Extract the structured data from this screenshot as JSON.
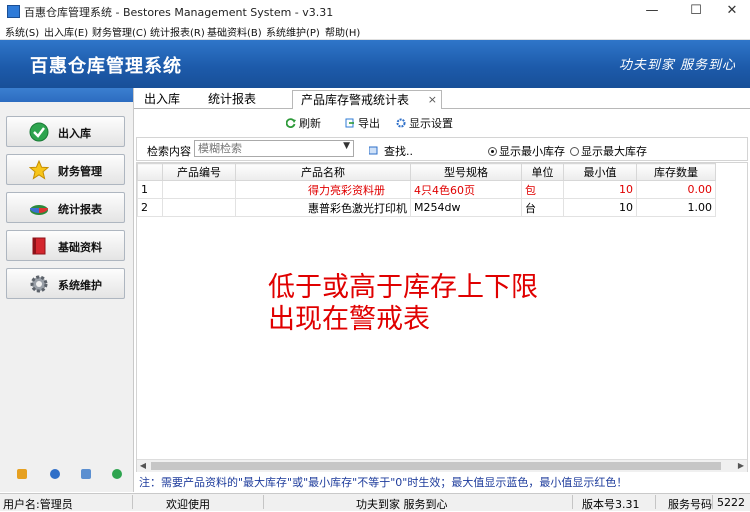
{
  "window": {
    "title": "百惠仓库管理系统 - Bestores Management System - v3.31",
    "minimize": "—",
    "maximize": "☐",
    "close": "✕"
  },
  "menu": [
    "系统(S)",
    "出入库(E)",
    "财务管理(C)",
    "统计报表(R)",
    "基础资料(B)",
    "系统维护(P)",
    "帮助(H)"
  ],
  "banner": {
    "logo": "百惠仓库管理系统",
    "slogan": "功夫到家 服务到心"
  },
  "nav": [
    {
      "label": "出入库",
      "icon": "green-check-icon"
    },
    {
      "label": "财务管理",
      "icon": "star-icon"
    },
    {
      "label": "统计报表",
      "icon": "pie-chart-icon"
    },
    {
      "label": "基础资料",
      "icon": "book-icon"
    },
    {
      "label": "系统维护",
      "icon": "gear-icon"
    }
  ],
  "tabs": [
    {
      "label": "出入库",
      "active": false
    },
    {
      "label": "统计报表",
      "active": false
    },
    {
      "label": "产品库存警戒统计表",
      "active": true,
      "close": "×"
    }
  ],
  "toolbar": {
    "refresh": "刷新",
    "export": "导出",
    "display_settings": "显示设置"
  },
  "search": {
    "label": "检索内容",
    "placeholder": "模糊检索",
    "find": "查找..",
    "radio_min": "显示最小库存",
    "radio_max": "显示最大库存",
    "selected": "min"
  },
  "table": {
    "columns": [
      "",
      "产品编号",
      "产品名称",
      "型号规格",
      "单位",
      "最小值",
      "库存数量"
    ],
    "rows": [
      {
        "idx": "1",
        "code": "",
        "name": "得力亮彩资料册",
        "spec": "4只4色60页",
        "unit": "包",
        "min": "10",
        "qty": "0.00",
        "highlight": "red"
      },
      {
        "idx": "2",
        "code": "",
        "name": "惠普彩色激光打印机",
        "spec": "M254dw",
        "unit": "台",
        "min": "10",
        "qty": "1.00",
        "highlight": ""
      }
    ]
  },
  "overlay_text": "低于或高于库存上下限\n出现在警戒表",
  "note": "注：需要产品资料的\"最大库存\"或\"最小库存\"不等于\"0\"时生效；最大值显示蓝色，最小值显示红色！",
  "status": {
    "user": "用户名:管理员",
    "welcome": "欢迎使用",
    "motto": "功夫到家 服务到心",
    "version": "版本号3.31",
    "service": "服务号码",
    "number": "5222"
  },
  "colors": {
    "banner": "#1d5bab",
    "alert": "#e00000",
    "note": "#1e3c9c"
  }
}
